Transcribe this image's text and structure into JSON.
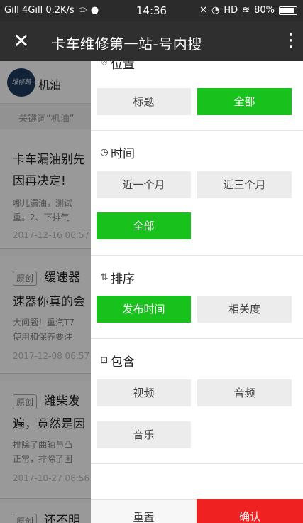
{
  "status_bar": {
    "signal_left": "Gıll 4Gıll 0.2K/s",
    "time": "14:36",
    "right": "HD",
    "battery": "80%",
    "icons": [
      "wechat-icon",
      "message-icon",
      "mute-icon",
      "alarm-icon",
      "wifi-icon",
      "battery-icon"
    ]
  },
  "header": {
    "title": "卡车维修第一站-号内搜",
    "close_icon": "close-icon",
    "more_icon": "more-icon"
  },
  "background": {
    "avatar_text": "维修館",
    "search_query": "机油",
    "hint": "关键词“机油”",
    "articles": [
      {
        "title_line1": "卡车漏油别先",
        "title_line2": "因再决定!",
        "snippet_line1": "哪儿漏油，测试",
        "snippet_line2": "重。2、下排气",
        "date": "2017-12-16 06:57"
      },
      {
        "tag": "原创",
        "title_line1": "缓速器",
        "title_line2": "速器你真的会",
        "snippet_line1": "大问题！重汽T7",
        "snippet_line2": "使用和保养要注",
        "date": "2017-12-08 06:57"
      },
      {
        "tag": "原创",
        "title_line1": "潍柴发",
        "title_line2": "遍，竟然是因",
        "snippet_line1": "排除了曲轴与凸",
        "snippet_line2": "正常，排除了困",
        "date": "2017-10-27 06:56"
      },
      {
        "tag": "原创",
        "title_line1": "还不明"
      }
    ]
  },
  "filter_panel": {
    "sections": [
      {
        "title": "位置",
        "icon": "location-pin-icon",
        "options": [
          {
            "label": "标题",
            "active": false
          },
          {
            "label": "全部",
            "active": true
          }
        ]
      },
      {
        "title": "时间",
        "icon": "clock-icon",
        "options": [
          {
            "label": "近一个月",
            "active": false
          },
          {
            "label": "近三个月",
            "active": false
          },
          {
            "label": "全部",
            "active": true
          }
        ]
      },
      {
        "title": "排序",
        "icon": "sort-icon",
        "options": [
          {
            "label": "发布时间",
            "active": true
          },
          {
            "label": "相关度",
            "active": false
          }
        ]
      },
      {
        "title": "包含",
        "icon": "include-box-icon",
        "options": [
          {
            "label": "视频",
            "active": false
          },
          {
            "label": "音频",
            "active": false
          },
          {
            "label": "音乐",
            "active": false
          }
        ]
      }
    ],
    "reset_label": "重置",
    "confirm_label": "确认"
  },
  "colors": {
    "accent_green": "#19c11c",
    "confirm_red": "#f02121",
    "title_bar": "#2f2f2f"
  }
}
